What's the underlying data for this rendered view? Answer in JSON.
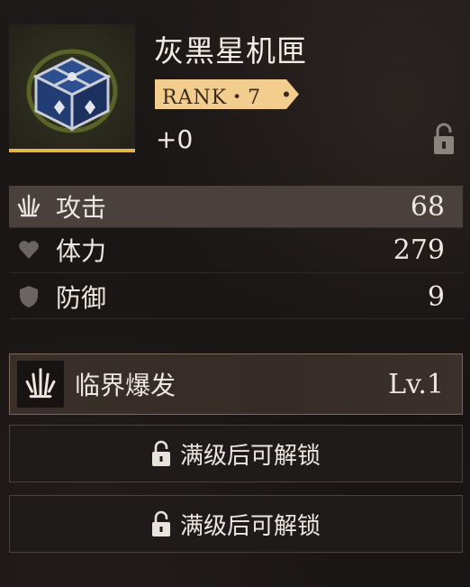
{
  "item": {
    "name": "灰黑星机匣",
    "rank_label": "RANK・7",
    "enhance_level": "+0",
    "thumbnail_icon": "steel-chest-icon",
    "locked": true,
    "accent_color": "#e2b74a"
  },
  "stats": [
    {
      "icon": "attack-icon",
      "label": "攻击",
      "value": "68",
      "highlighted": true
    },
    {
      "icon": "heart-icon",
      "label": "体力",
      "value": "279",
      "highlighted": false
    },
    {
      "icon": "shield-icon",
      "label": "防御",
      "value": "9",
      "highlighted": false
    }
  ],
  "skill": {
    "icon": "attack-icon",
    "name": "临界爆发",
    "level": "Lv.1"
  },
  "locked_slots": [
    {
      "icon": "lock-icon",
      "label": "满级后可解锁"
    },
    {
      "icon": "lock-icon",
      "label": "满级后可解锁"
    }
  ],
  "colors": {
    "rank_tag": "#f2cd8e",
    "highlight_row": "#4a403c",
    "skill_border": "#7c6a5a"
  }
}
